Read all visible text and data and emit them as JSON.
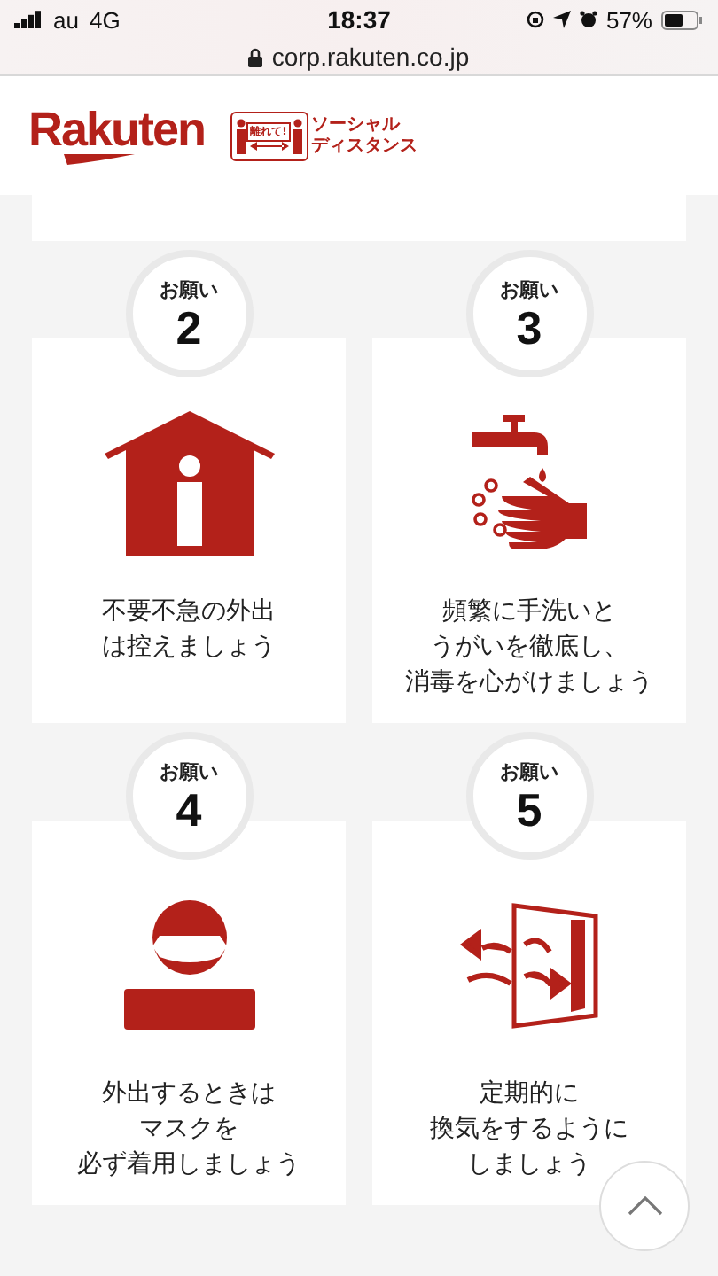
{
  "status_bar": {
    "carrier": "au",
    "network": "4G",
    "time": "18:37",
    "battery": "57%"
  },
  "address_bar": {
    "url": "corp.rakuten.co.jp"
  },
  "header": {
    "logo": "Rakuten",
    "badge": {
      "caption": "離れて!",
      "title_lines": [
        "ソーシャル",
        "ディスタンス"
      ]
    }
  },
  "cards": [
    {
      "kind": "house",
      "label": "お願い",
      "number": "2",
      "lines": [
        "不要不急の外出",
        "は控えましょう"
      ]
    },
    {
      "kind": "handwash",
      "label": "お願い",
      "number": "3",
      "lines": [
        "頻繁に手洗いと",
        "うがいを徹底し、",
        "消毒を心がけましょう"
      ]
    },
    {
      "kind": "mask",
      "label": "お願い",
      "number": "4",
      "lines": [
        "外出するときは",
        "マスクを",
        "必ず着用しましょう"
      ]
    },
    {
      "kind": "ventilation",
      "label": "お願い",
      "number": "5",
      "lines": [
        "定期的に",
        "換気をするように",
        "しましょう"
      ]
    }
  ]
}
